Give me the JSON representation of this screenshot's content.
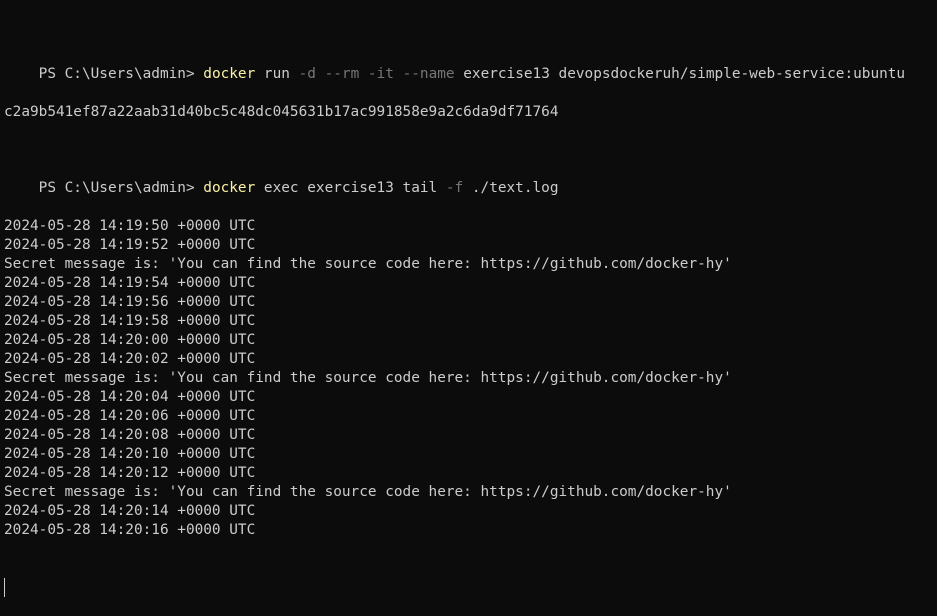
{
  "terminal": {
    "prompt": "PS C:\\Users\\admin> ",
    "cmd1": {
      "program": "docker",
      "parts": [
        {
          "text": " run ",
          "kind": "arg"
        },
        {
          "text": "-d",
          "kind": "flag"
        },
        {
          "text": " ",
          "kind": "arg"
        },
        {
          "text": "--rm",
          "kind": "flag"
        },
        {
          "text": " ",
          "kind": "arg"
        },
        {
          "text": "-it",
          "kind": "flag"
        },
        {
          "text": " ",
          "kind": "arg"
        },
        {
          "text": "--name",
          "kind": "flag"
        },
        {
          "text": " exercise13 devopsdockeruh/simple-web-service:ubuntu",
          "kind": "arg"
        }
      ]
    },
    "container_id": "c2a9b541ef87a22aab31d40bc5c48dc045631b17ac991858e9a2c6da9df71764",
    "cmd2": {
      "program": "docker",
      "parts": [
        {
          "text": " exec exercise13 tail ",
          "kind": "arg"
        },
        {
          "text": "-f",
          "kind": "flag"
        },
        {
          "text": " ./text.log",
          "kind": "arg"
        }
      ]
    },
    "log_lines": [
      "2024-05-28 14:19:50 +0000 UTC",
      "2024-05-28 14:19:52 +0000 UTC",
      "Secret message is: 'You can find the source code here: https://github.com/docker-hy'",
      "2024-05-28 14:19:54 +0000 UTC",
      "2024-05-28 14:19:56 +0000 UTC",
      "2024-05-28 14:19:58 +0000 UTC",
      "2024-05-28 14:20:00 +0000 UTC",
      "2024-05-28 14:20:02 +0000 UTC",
      "Secret message is: 'You can find the source code here: https://github.com/docker-hy'",
      "2024-05-28 14:20:04 +0000 UTC",
      "2024-05-28 14:20:06 +0000 UTC",
      "2024-05-28 14:20:08 +0000 UTC",
      "2024-05-28 14:20:10 +0000 UTC",
      "2024-05-28 14:20:12 +0000 UTC",
      "Secret message is: 'You can find the source code here: https://github.com/docker-hy'",
      "2024-05-28 14:20:14 +0000 UTC",
      "2024-05-28 14:20:16 +0000 UTC"
    ]
  }
}
